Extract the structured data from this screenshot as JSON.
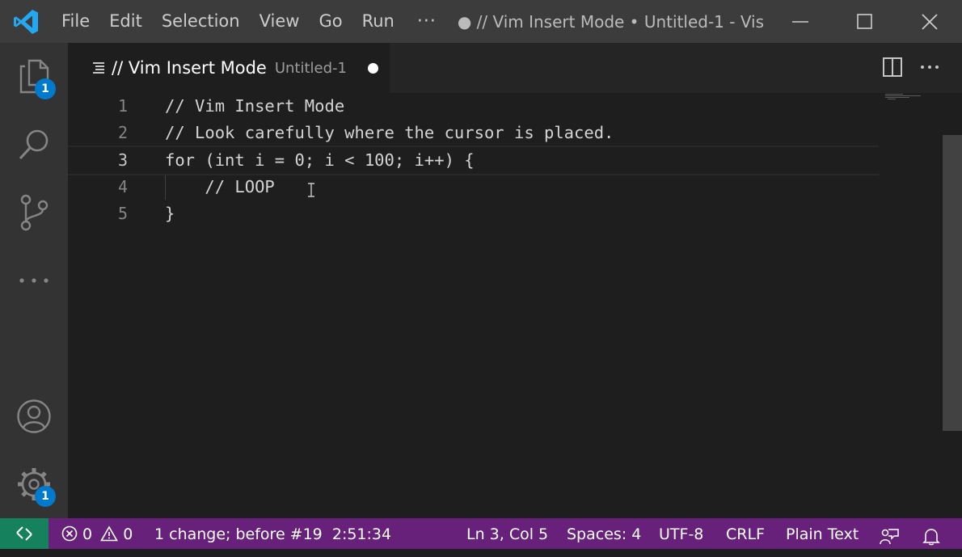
{
  "titlebar": {
    "menu": [
      "File",
      "Edit",
      "Selection",
      "View",
      "Go",
      "Run"
    ],
    "more": "···",
    "window_title": "● // Vim Insert Mode • Untitled-1 - Vis..."
  },
  "activity": {
    "explorer_badge": "1",
    "settings_badge": "1"
  },
  "tab": {
    "title": "// Vim Insert Mode",
    "description": "Untitled-1"
  },
  "editor": {
    "lines": [
      {
        "number": "1",
        "text": "// Vim Insert Mode"
      },
      {
        "number": "2",
        "text": "// Look carefully where the cursor is placed."
      },
      {
        "number": "3",
        "text": "for (int i = 0; i < 100; i++) {"
      },
      {
        "number": "4",
        "text": "    // LOOP"
      },
      {
        "number": "5",
        "text": "}"
      }
    ],
    "active_line": 3
  },
  "statusbar": {
    "errors": "0",
    "warnings": "0",
    "history": "1 change; before #19  2:51:34",
    "position": "Ln 3, Col 5",
    "indent": "Spaces: 4",
    "encoding": "UTF-8",
    "eol": "CRLF",
    "language": "Plain Text"
  },
  "colors": {
    "titlebar": "#3c3c3c",
    "activitybar": "#333333",
    "editor": "#1e1e1e",
    "statusbar": "#68217a",
    "remote": "#16825d",
    "badge": "#007acc",
    "logo": "#23a9f2"
  },
  "icons": [
    "vscode-logo-icon",
    "minimize-icon",
    "maximize-icon",
    "close-icon",
    "files-icon",
    "search-icon",
    "source-control-icon",
    "ellipsis-icon",
    "account-icon",
    "gear-icon",
    "list-icon",
    "split-editor-icon",
    "more-actions-icon",
    "remote-icon",
    "error-icon",
    "warning-icon",
    "feedback-icon",
    "bell-icon"
  ]
}
